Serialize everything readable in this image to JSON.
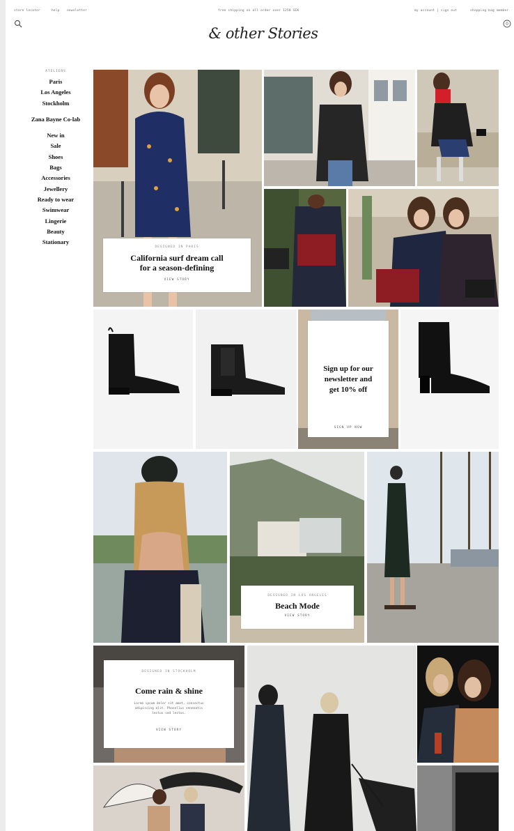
{
  "topbar": {
    "store_locator": "store locator",
    "help": "help",
    "newsletter": "newsletter",
    "shipping_notice": "free shipping on all order over 1250 SEK",
    "account": "my account | sign out",
    "shopping_bag": "shopping bag member"
  },
  "brand": {
    "logo": "& other Stories"
  },
  "sidebar": {
    "heading": "ATELIERS",
    "ateliers": [
      "Paris",
      "Los Angeles",
      "Stockholm"
    ],
    "colab": "Zana Bayne Co-lab",
    "categories": [
      "New in",
      "Sale",
      "Shoes",
      "Bags",
      "Accessories",
      "Jewellery",
      "Ready to wear",
      "Swimwear",
      "Lingerie",
      "Beauty",
      "Stationary"
    ]
  },
  "cards": {
    "paris": {
      "kicker": "DESIGNED IN PARIS",
      "title_line1": "California surf dream call",
      "title_line2": "for a season-defining",
      "cta": "VIEW STORY"
    },
    "newsletter": {
      "line1": "Sign up for our",
      "line2": "newsletter and",
      "line3": "get 10% off",
      "cta": "SIGN UP NOW"
    },
    "la": {
      "kicker": "DESIGNED IN LOS ANGELES",
      "title": "Beach Mode",
      "cta": "VIEW STORY"
    },
    "stockholm": {
      "kicker": "DESIGNED IN STOCKHOLM",
      "title": "Come rain & shine",
      "body_line1": "Lorem ipsum dolor sit amet, consectus",
      "body_line2": "adipiscing elit. Phasellus venenatis",
      "body_line3": "lectus sed lectus.",
      "cta": "VIEW STORY"
    }
  },
  "colors": {
    "page_bg": "#ececec",
    "content_bg": "#ffffff",
    "text": "#111111",
    "muted": "#777777"
  }
}
